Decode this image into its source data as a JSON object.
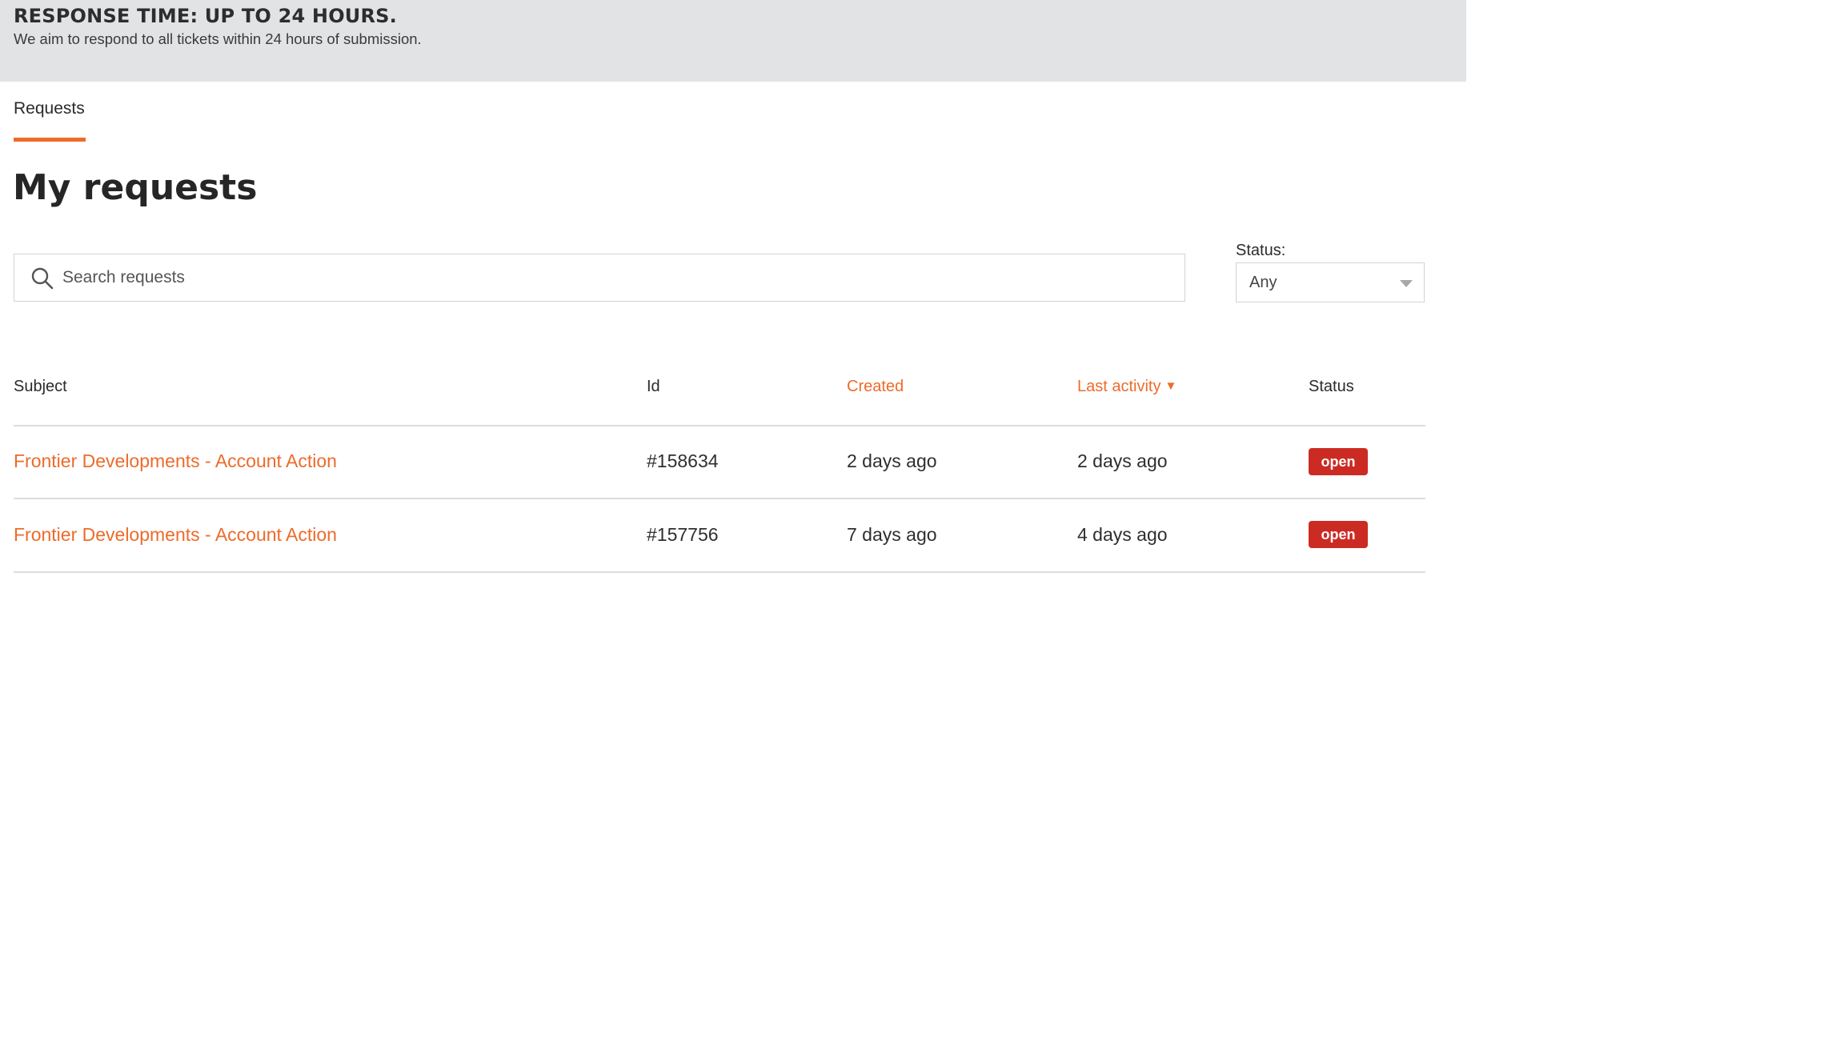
{
  "banner": {
    "title": "RESPONSE TIME: UP TO 24 HOURS.",
    "subtitle": "We aim to respond to all tickets within 24 hours of submission."
  },
  "tabs": [
    {
      "label": "Requests",
      "active": true
    }
  ],
  "page_title": "My requests",
  "search": {
    "placeholder": "Search requests",
    "value": "",
    "icon": "search-icon"
  },
  "status_filter": {
    "label": "Status:",
    "selected": "Any"
  },
  "table": {
    "columns": {
      "subject": "Subject",
      "id": "Id",
      "created": "Created",
      "last_activity": "Last activity",
      "status": "Status"
    },
    "sort_indicator": "▼",
    "rows": [
      {
        "subject": "Frontier Developments - Account Action",
        "id": "#158634",
        "created": "2 days ago",
        "last_activity": "2 days ago",
        "status": "open"
      },
      {
        "subject": "Frontier Developments - Account Action",
        "id": "#157756",
        "created": "7 days ago",
        "last_activity": "4 days ago",
        "status": "open"
      }
    ]
  },
  "colors": {
    "accent": "#ed6b2b",
    "badge_open": "#cc2b23",
    "banner_bg": "#e2e3e5"
  }
}
